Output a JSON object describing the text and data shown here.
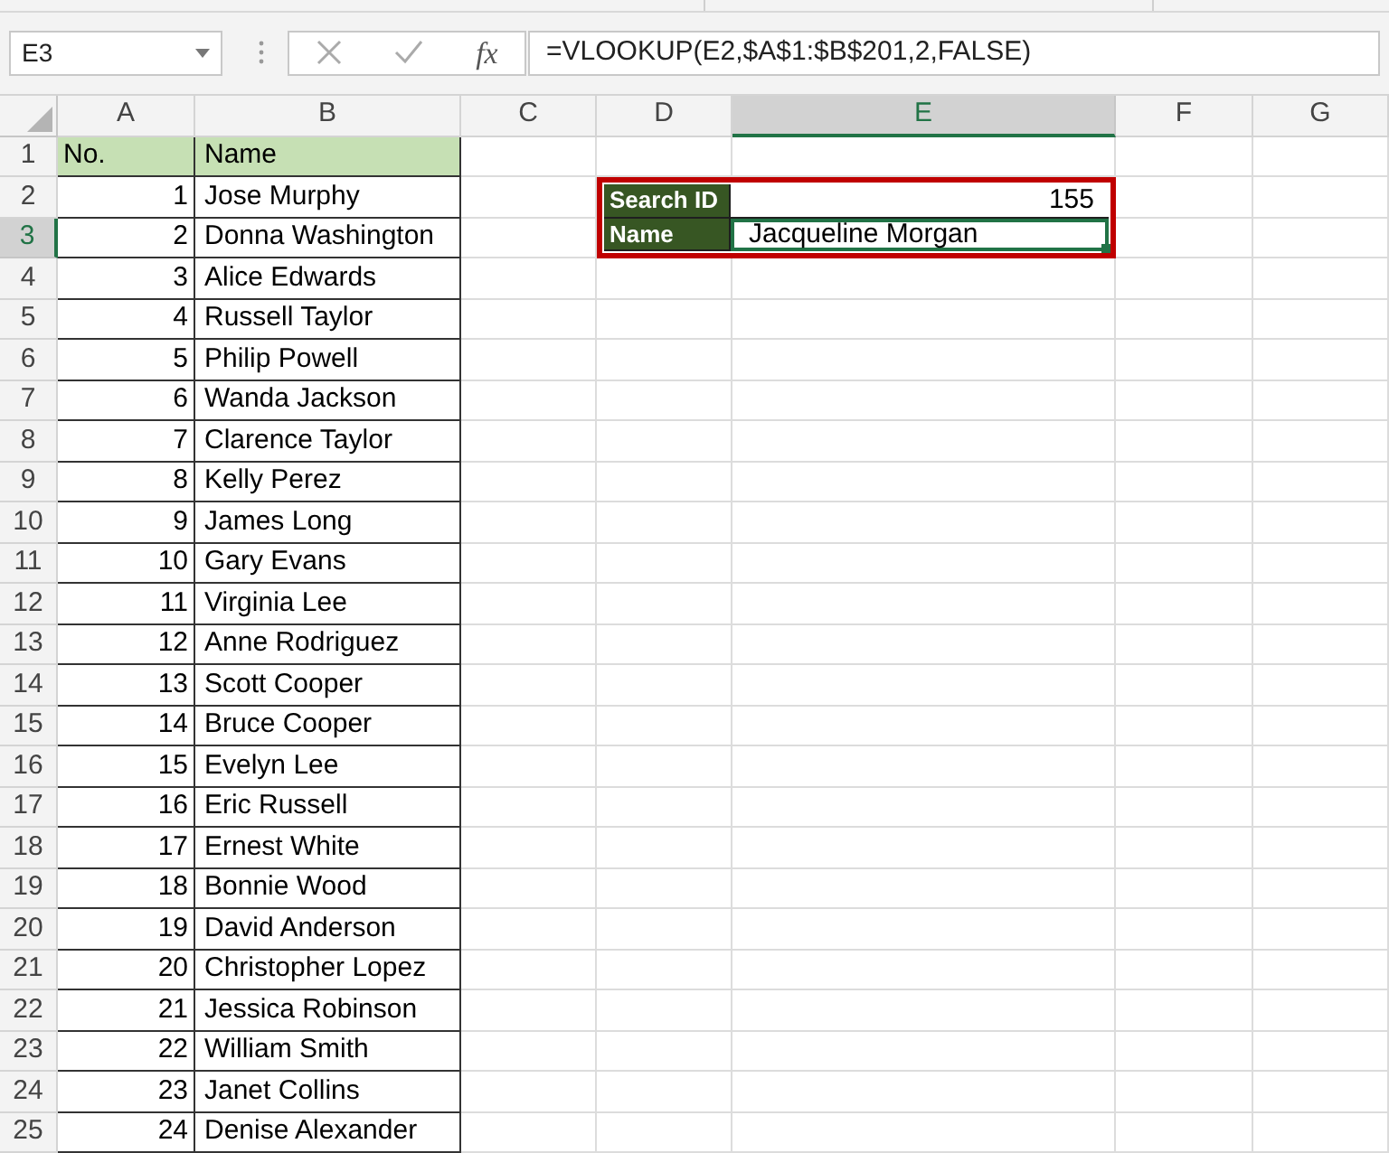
{
  "name_box": {
    "value": "E3"
  },
  "function_button": "fx",
  "formula": "=VLOOKUP(E2,$A$1:$B$201,2,FALSE)",
  "columns": [
    {
      "label": "A",
      "selected": false
    },
    {
      "label": "B",
      "selected": false
    },
    {
      "label": "C",
      "selected": false
    },
    {
      "label": "D",
      "selected": false
    },
    {
      "label": "E",
      "selected": true
    },
    {
      "label": "F",
      "selected": false
    },
    {
      "label": "G",
      "selected": false
    }
  ],
  "rows": [
    {
      "label": "1",
      "selected": false
    },
    {
      "label": "2",
      "selected": false
    },
    {
      "label": "3",
      "selected": true
    },
    {
      "label": "4",
      "selected": false
    },
    {
      "label": "5",
      "selected": false
    },
    {
      "label": "6",
      "selected": false
    },
    {
      "label": "7",
      "selected": false
    },
    {
      "label": "8",
      "selected": false
    },
    {
      "label": "9",
      "selected": false
    },
    {
      "label": "10",
      "selected": false
    },
    {
      "label": "11",
      "selected": false
    },
    {
      "label": "12",
      "selected": false
    },
    {
      "label": "13",
      "selected": false
    },
    {
      "label": "14",
      "selected": false
    },
    {
      "label": "15",
      "selected": false
    },
    {
      "label": "16",
      "selected": false
    },
    {
      "label": "17",
      "selected": false
    },
    {
      "label": "18",
      "selected": false
    },
    {
      "label": "19",
      "selected": false
    },
    {
      "label": "20",
      "selected": false
    },
    {
      "label": "21",
      "selected": false
    },
    {
      "label": "22",
      "selected": false
    },
    {
      "label": "23",
      "selected": false
    },
    {
      "label": "24",
      "selected": false
    },
    {
      "label": "25",
      "selected": false
    }
  ],
  "table": {
    "header": [
      "No.",
      "Name"
    ],
    "rows": [
      [
        "1",
        "Jose Murphy"
      ],
      [
        "2",
        "Donna Washington"
      ],
      [
        "3",
        "Alice Edwards"
      ],
      [
        "4",
        "Russell Taylor"
      ],
      [
        "5",
        "Philip Powell"
      ],
      [
        "6",
        "Wanda Jackson"
      ],
      [
        "7",
        "Clarence Taylor"
      ],
      [
        "8",
        "Kelly Perez"
      ],
      [
        "9",
        "James Long"
      ],
      [
        "10",
        "Gary Evans"
      ],
      [
        "11",
        "Virginia Lee"
      ],
      [
        "12",
        "Anne Rodriguez"
      ],
      [
        "13",
        "Scott Cooper"
      ],
      [
        "14",
        "Bruce Cooper"
      ],
      [
        "15",
        "Evelyn Lee"
      ],
      [
        "16",
        "Eric Russell"
      ],
      [
        "17",
        "Ernest White"
      ],
      [
        "18",
        "Bonnie Wood"
      ],
      [
        "19",
        "David Anderson"
      ],
      [
        "20",
        "Christopher Lopez"
      ],
      [
        "21",
        "Jessica Robinson"
      ],
      [
        "22",
        "William Smith"
      ],
      [
        "23",
        "Janet Collins"
      ],
      [
        "24",
        "Denise Alexander"
      ]
    ]
  },
  "lookup": {
    "rows": [
      {
        "label": "Search ID",
        "value": "155",
        "kind": "number",
        "selected": false
      },
      {
        "label": "Name",
        "value": "Jacqueline Morgan",
        "kind": "text",
        "selected": true
      }
    ]
  }
}
